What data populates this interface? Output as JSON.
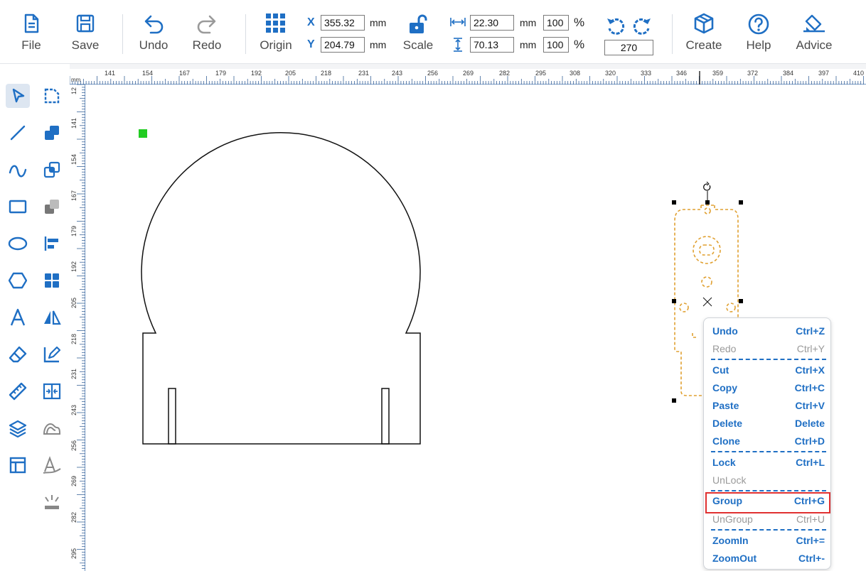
{
  "toolbar": {
    "file": "File",
    "save": "Save",
    "undo": "Undo",
    "redo": "Redo",
    "origin": "Origin",
    "scale": "Scale",
    "create": "Create",
    "help": "Help",
    "advice": "Advice",
    "x_label": "X",
    "y_label": "Y",
    "x_value": "355.32",
    "y_value": "204.79",
    "unit_mm": "mm",
    "width_value": "22.30",
    "height_value": "70.13",
    "width_pct": "100",
    "height_pct": "100",
    "pct_symbol": "%",
    "rotation_value": "270"
  },
  "ruler": {
    "unit": "mm",
    "top_labels": [
      "141",
      "154",
      "167",
      "179",
      "192",
      "205",
      "218",
      "231",
      "243",
      "256",
      "269",
      "282",
      "295",
      "308",
      "320",
      "333",
      "346",
      "359",
      "372",
      "384",
      "397",
      "410"
    ],
    "left_labels": [
      "12",
      "141",
      "154",
      "167",
      "179",
      "192",
      "205",
      "218",
      "231",
      "243",
      "256",
      "269",
      "282",
      "295"
    ]
  },
  "tools": [
    "select-icon",
    "node-edit-icon",
    "line-icon",
    "union-icon",
    "curve-icon",
    "duplicate-icon",
    "rectangle-icon",
    "subtract-icon",
    "ellipse-icon",
    "align-left-icon",
    "polygon-icon",
    "grid-icon",
    "text-icon",
    "mirror-icon",
    "eraser-icon",
    "measure-edit-icon",
    "ruler-icon",
    "distribute-icon",
    "layers-icon",
    "offset-icon",
    "layout-icon",
    "pen-tool-icon",
    "laser-icon"
  ],
  "context_menu": {
    "items": [
      {
        "label": "Undo",
        "shortcut": "Ctrl+Z",
        "enabled": true
      },
      {
        "label": "Redo",
        "shortcut": "Ctrl+Y",
        "enabled": false
      },
      {
        "label": "Cut",
        "shortcut": "Ctrl+X",
        "enabled": true
      },
      {
        "label": "Copy",
        "shortcut": "Ctrl+C",
        "enabled": true
      },
      {
        "label": "Paste",
        "shortcut": "Ctrl+V",
        "enabled": true
      },
      {
        "label": "Delete",
        "shortcut": "Delete",
        "enabled": true
      },
      {
        "label": "Clone",
        "shortcut": "Ctrl+D",
        "enabled": true
      },
      {
        "label": "Lock",
        "shortcut": "Ctrl+L",
        "enabled": true
      },
      {
        "label": "UnLock",
        "shortcut": "",
        "enabled": false
      },
      {
        "label": "Group",
        "shortcut": "Ctrl+G",
        "enabled": true,
        "highlighted": true
      },
      {
        "label": "UnGroup",
        "shortcut": "Ctrl+U",
        "enabled": false
      },
      {
        "label": "ZoomIn",
        "shortcut": "Ctrl+=",
        "enabled": true
      },
      {
        "label": "ZoomOut",
        "shortcut": "Ctrl+-",
        "enabled": true
      }
    ]
  },
  "colors": {
    "accent": "#1f6fc4",
    "selection": "#e0a030",
    "origin_marker": "#22cc22",
    "highlight": "#e03030"
  }
}
